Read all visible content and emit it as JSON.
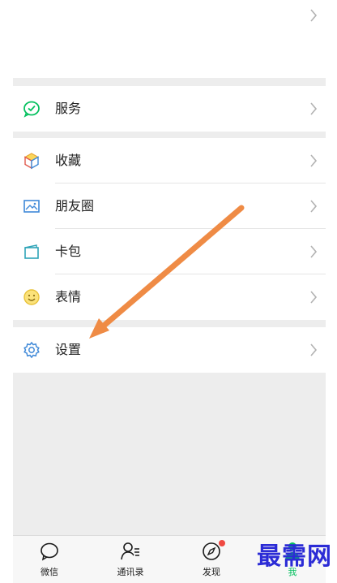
{
  "menu": {
    "services": {
      "label": "服务",
      "icon": "wechat-pay-icon"
    },
    "favorites": {
      "label": "收藏",
      "icon": "cube-icon"
    },
    "moments": {
      "label": "朋友圈",
      "icon": "picture-icon"
    },
    "card_wallet": {
      "label": "卡包",
      "icon": "card-icon"
    },
    "stickers": {
      "label": "表情",
      "icon": "smiley-icon"
    },
    "settings": {
      "label": "设置",
      "icon": "gear-icon"
    }
  },
  "tabbar": {
    "tabs": [
      {
        "label": "微信",
        "icon": "chat-bubble-icon"
      },
      {
        "label": "通讯录",
        "icon": "contacts-icon"
      },
      {
        "label": "发现",
        "icon": "compass-icon",
        "badge": true
      },
      {
        "label": "我",
        "icon": "person-icon"
      }
    ]
  },
  "watermark": "最需网",
  "colors": {
    "accent_green": "#07c160",
    "arrow": "#ef8b45",
    "badge_red": "#f04a42",
    "watermark_blue": "#2b2bd6"
  }
}
